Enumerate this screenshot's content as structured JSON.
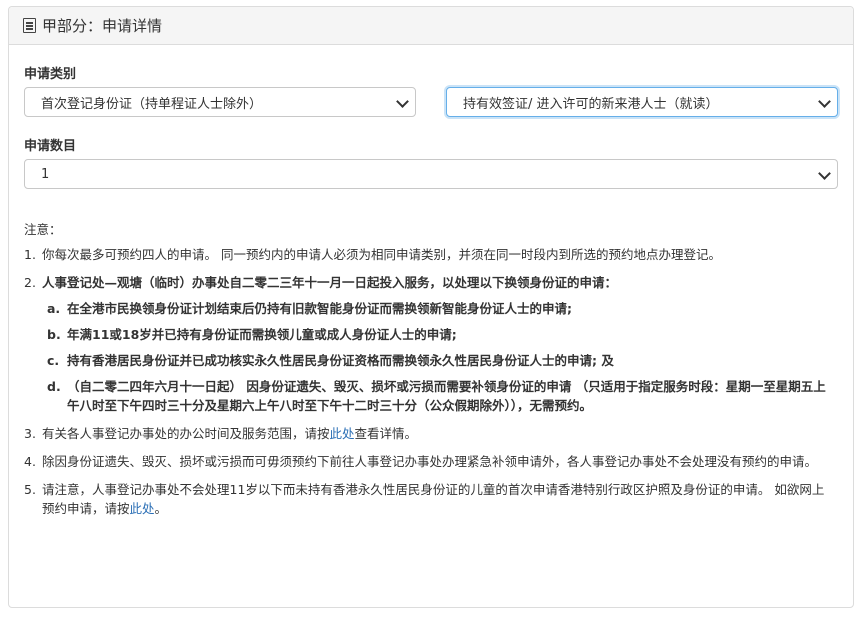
{
  "panel": {
    "icon": "document-list-icon",
    "title": "甲部分：申请详情"
  },
  "form": {
    "category_label": "申请类别",
    "category_select_1": "首次登记身份证（持单程证人士除外）",
    "category_select_2": "持有效签证/ 进入许可的新来港人士（就读）",
    "count_label": "申请数目",
    "count_select": "1"
  },
  "notes": {
    "heading": "注意：",
    "item1": {
      "num": "1.",
      "text": "你每次最多可预约四人的申请。 同一预约内的申请人必须为相同申请类别，并须在同一时段内到所选的预约地点办理登记。"
    },
    "item2": {
      "num": "2.",
      "text": "人事登记处—观塘（临时）办事处自二零二三年十一月一日起投入服务，以处理以下换领身份证的申请：",
      "subs": [
        {
          "letter": "a.",
          "text": "在全港市民换领身份证计划结束后仍持有旧款智能身份证而需换领新智能身份证人士的申请;"
        },
        {
          "letter": "b.",
          "text": "年满11或18岁并已持有身份证而需换领儿童或成人身份证人士的申请;"
        },
        {
          "letter": "c.",
          "text": "持有香港居民身份证并已成功核实永久性居民身份证资格而需换领永久性居民身份证人士的申请; 及"
        },
        {
          "letter": "d.",
          "text": "（自二零二四年六月十一日起） 因身份证遗失、毁灭、损坏或污损而需要补领身份证的申请 （只适用于指定服务时段：星期一至星期五上午八时至下午四时三十分及星期六上午八时至下午十二时三十分（公众假期除外）），无需预约。"
        }
      ]
    },
    "item3": {
      "num": "3.",
      "text_before": "有关各人事登记办事处的办公时间及服务范围，请按",
      "link": "此处",
      "text_after": "查看详情。"
    },
    "item4": {
      "num": "4.",
      "text": "除因身份证遗失、毁灭、损坏或污损而可毋须预约下前往人事登记办事处办理紧急补领申请外，各人事登记办事处不会处理没有预约的申请。"
    },
    "item5": {
      "num": "5.",
      "text_before": "请注意，人事登记办事处不会处理11岁以下而未持有香港永久性居民身份证的儿童的首次申请香港特别行政区护照及身份证的申请。 如欲网上预约申请，请按",
      "link": "此处",
      "text_after": "。"
    }
  }
}
